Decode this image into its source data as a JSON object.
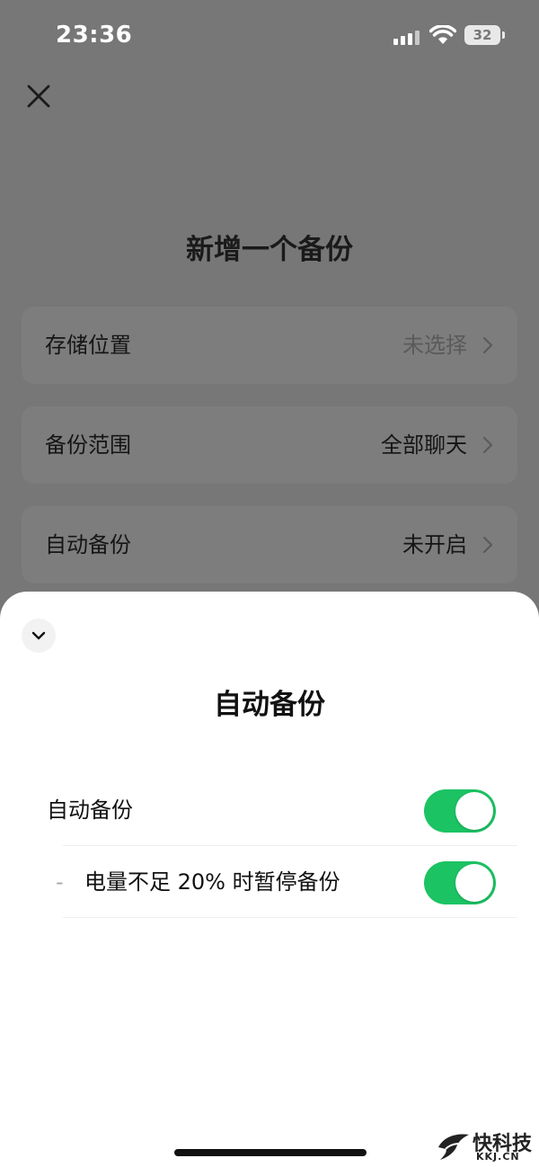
{
  "status_bar": {
    "time": "23:36",
    "battery": "32"
  },
  "page": {
    "title": "新增一个备份",
    "rows": [
      {
        "label": "存储位置",
        "value": "未选择",
        "muted": true
      },
      {
        "label": "备份范围",
        "value": "全部聊天",
        "muted": false
      },
      {
        "label": "自动备份",
        "value": "未开启",
        "muted": false
      }
    ]
  },
  "sheet": {
    "title": "自动备份",
    "toggles": [
      {
        "label": "自动备份",
        "on": true
      },
      {
        "prefix": "-",
        "label": "电量不足 20% 时暂停备份",
        "on": true
      }
    ]
  },
  "watermark": {
    "text": "快科技",
    "sub": "KKJ.CN"
  },
  "colors": {
    "accent": "#1cc363",
    "overlay": "#777777"
  }
}
